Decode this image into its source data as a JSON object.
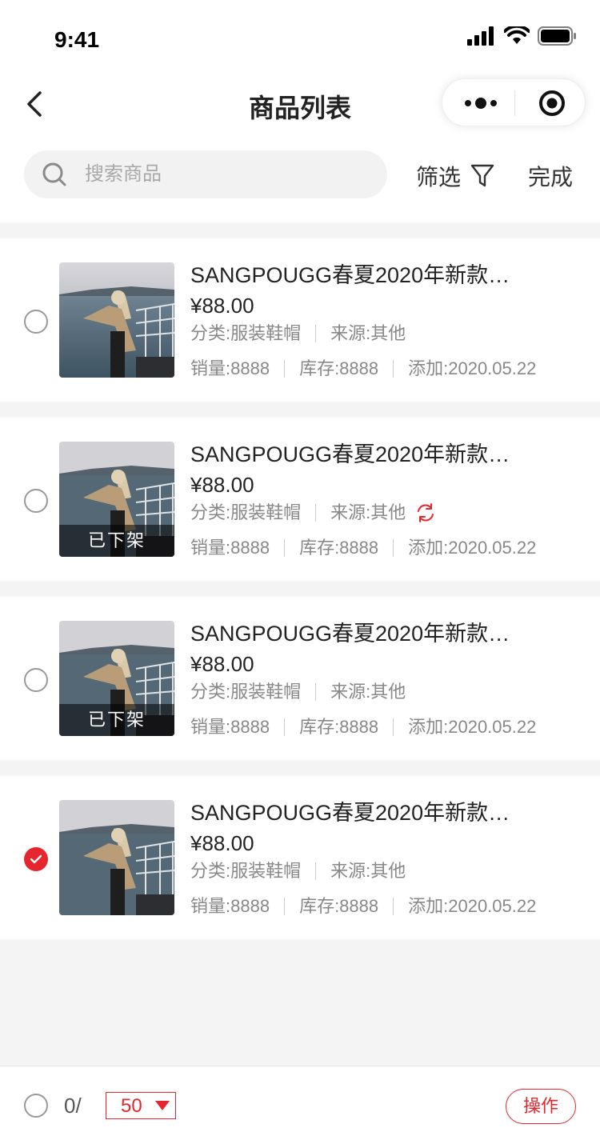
{
  "status_bar": {
    "time": "9:41"
  },
  "nav": {
    "title": "商品列表"
  },
  "search": {
    "placeholder": "搜索商品"
  },
  "toolbar": {
    "filter_label": "筛选",
    "done_label": "完成"
  },
  "products": [
    {
      "title": "SANGPOUGG春夏2020年新款…",
      "price": "¥88.00",
      "category": "分类:服装鞋帽",
      "source": "来源:其他",
      "sales": "销量:8888",
      "stock": "库存:8888",
      "added": "添加:2020.05.22",
      "status_label": "",
      "selected": false,
      "sync_icon": false
    },
    {
      "title": "SANGPOUGG春夏2020年新款…",
      "price": "¥88.00",
      "category": "分类:服装鞋帽",
      "source": "来源:其他",
      "sales": "销量:8888",
      "stock": "库存:8888",
      "added": "添加:2020.05.22",
      "status_label": "已下架",
      "selected": false,
      "sync_icon": true
    },
    {
      "title": "SANGPOUGG春夏2020年新款…",
      "price": "¥88.00",
      "category": "分类:服装鞋帽",
      "source": "来源:其他",
      "sales": "销量:8888",
      "stock": "库存:8888",
      "added": "添加:2020.05.22",
      "status_label": "已下架",
      "selected": false,
      "sync_icon": false
    },
    {
      "title": "SANGPOUGG春夏2020年新款…",
      "price": "¥88.00",
      "category": "分类:服装鞋帽",
      "source": "来源:其他",
      "sales": "销量:8888",
      "stock": "库存:8888",
      "added": "添加:2020.05.22",
      "status_label": "",
      "selected": true,
      "sync_icon": false
    }
  ],
  "bottom_bar": {
    "selected_count": "0/",
    "page_size": "50",
    "action_label": "操作"
  },
  "colors": {
    "accent": "#e6262e",
    "background": "#f4f4f4"
  },
  "icons": [
    "back-icon",
    "more-icon",
    "close-icon",
    "search-icon",
    "filter-icon",
    "sync-icon",
    "check-icon",
    "dropdown-icon",
    "signal-icon",
    "wifi-icon",
    "battery-icon"
  ]
}
